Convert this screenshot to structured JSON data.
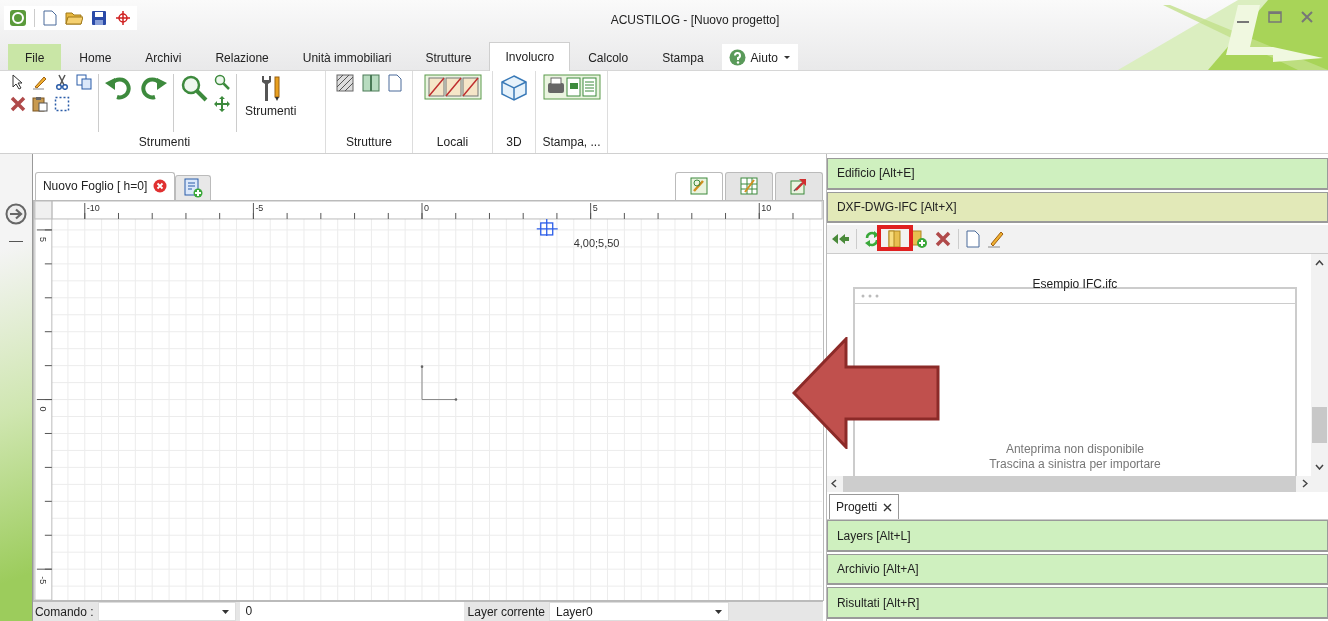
{
  "window": {
    "title": "ACUSTILOG - [Nuovo progetto]"
  },
  "menu_tabs": [
    {
      "label": "File",
      "kind": "file",
      "selected": false
    },
    {
      "label": "Home",
      "kind": "tab",
      "selected": false
    },
    {
      "label": "Archivi",
      "kind": "tab",
      "selected": false
    },
    {
      "label": "Relazione",
      "kind": "tab",
      "selected": false
    },
    {
      "label": "Unità immobiliari",
      "kind": "tab",
      "selected": false
    },
    {
      "label": "Strutture",
      "kind": "tab",
      "selected": false
    },
    {
      "label": "Involucro",
      "kind": "tab",
      "selected": true
    },
    {
      "label": "Calcolo",
      "kind": "tab",
      "selected": false
    },
    {
      "label": "Stampa",
      "kind": "tab",
      "selected": false
    },
    {
      "label": "Aiuto",
      "kind": "help",
      "selected": false
    }
  ],
  "ribbon": {
    "big_button": "Strumenti",
    "groups": [
      "Strumenti",
      "Strutture",
      "Locali",
      "3D",
      "Stampa, ..."
    ]
  },
  "sheet_tabs": [
    {
      "label": "Nuovo Foglio [ h=0]",
      "selected": true
    }
  ],
  "view_tabs": [
    {
      "selected": true
    },
    {
      "selected": false
    },
    {
      "selected": false
    }
  ],
  "ruler": {
    "x_labels": [
      "-10",
      "-5",
      "0",
      "5",
      "10"
    ],
    "y_labels": [
      "5",
      "0",
      "-5"
    ]
  },
  "cursor_readout": "4,00;5,50",
  "command_bar": {
    "label": "Comando :",
    "value": "0",
    "layer_label": "Layer corrente",
    "layer_value": "Layer0"
  },
  "panels_top": [
    {
      "label": "Edificio [Alt+E]",
      "selected": false
    },
    {
      "label": "DXF-DWG-IFC [Alt+X]",
      "selected": true
    }
  ],
  "preview": {
    "file_name": "Esempio IFC.ifc",
    "message": "Anteprima non disponibile",
    "hint": "Trascina a sinistra per importare"
  },
  "bottom_tab": {
    "label": "Progetti"
  },
  "panels_bottom": [
    {
      "label": "Layers [Alt+L]"
    },
    {
      "label": "Archivio [Alt+A]"
    },
    {
      "label": "Risultati [Alt+R]"
    }
  ]
}
